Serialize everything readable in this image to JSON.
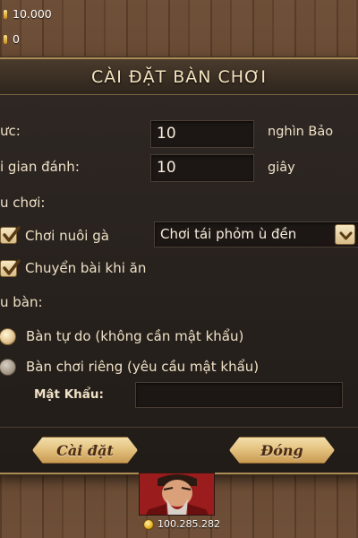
{
  "stats": {
    "money": "10.000",
    "secondary": "0"
  },
  "dialog": {
    "title": "CÀI ĐẶT BÀN CHƠI",
    "bet": {
      "label": "ưc:",
      "value": "10",
      "unit": "nghìn Bảo"
    },
    "time": {
      "label": "i gian đánh:",
      "value": "10",
      "unit": "giây"
    },
    "rules_label": "u chơi:",
    "options": {
      "raise_chicken": {
        "label": "Chơi nuôi gà",
        "checked": true
      },
      "transfer_on_eat": {
        "label": "Chuyển bài khi ăn",
        "checked": true
      }
    },
    "rule_select": {
      "value": "Chơi tái phỏm ù đền"
    },
    "table_type_label": "u bàn:",
    "table_types": {
      "free": {
        "label": "Bàn tự do (không cần mật khẩu)",
        "selected": true
      },
      "private": {
        "label": "Bàn chơi riêng (yêu cầu mật khẩu)",
        "selected": false
      }
    },
    "password": {
      "label": "Mật Khẩu:",
      "value": ""
    },
    "buttons": {
      "save": "Cài đặt",
      "close": "Đóng"
    }
  },
  "player": {
    "coins": "100.285.282"
  },
  "colors": {
    "accent": "#d8bd86",
    "button": "#e2c07c",
    "dialog_bg": "#27211d",
    "avatar_bg": "#a31d1d"
  },
  "icons": {
    "check": "checkmark-icon",
    "dropdown": "chevron-down-icon",
    "coin": "coin-icon",
    "stat": "gold-bar-icon"
  }
}
